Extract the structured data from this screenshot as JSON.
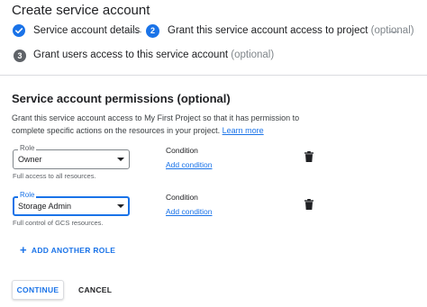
{
  "page": {
    "title": "Create service account"
  },
  "stepper": {
    "step1": {
      "label": "Service account details",
      "icon": "check-circle-icon"
    },
    "step2": {
      "number": "2",
      "label": "Grant this service account access to project",
      "optional": "(optional)"
    },
    "step3": {
      "number": "3",
      "label": "Grant users access to this service account",
      "optional": "(optional)"
    }
  },
  "permissions": {
    "title": "Service account permissions (optional)",
    "description": "Grant this service account access to My First Project so that it has permission to complete specific actions on the resources in your project.",
    "learn_more": "Learn more",
    "roles": [
      {
        "label": "Role",
        "value": "Owner",
        "helper": "Full access to all resources.",
        "condition_label": "Condition",
        "condition_link": "Add condition",
        "active": false
      },
      {
        "label": "Role",
        "value": "Storage Admin",
        "helper": "Full control of GCS resources.",
        "condition_label": "Condition",
        "condition_link": "Add condition",
        "active": true
      }
    ],
    "add_role": "ADD ANOTHER ROLE"
  },
  "actions": {
    "continue": "CONTINUE",
    "cancel": "CANCEL"
  },
  "colors": {
    "accent": "#1a73e8",
    "text": "#202124",
    "muted": "#5f6368",
    "divider": "#dadce0"
  }
}
